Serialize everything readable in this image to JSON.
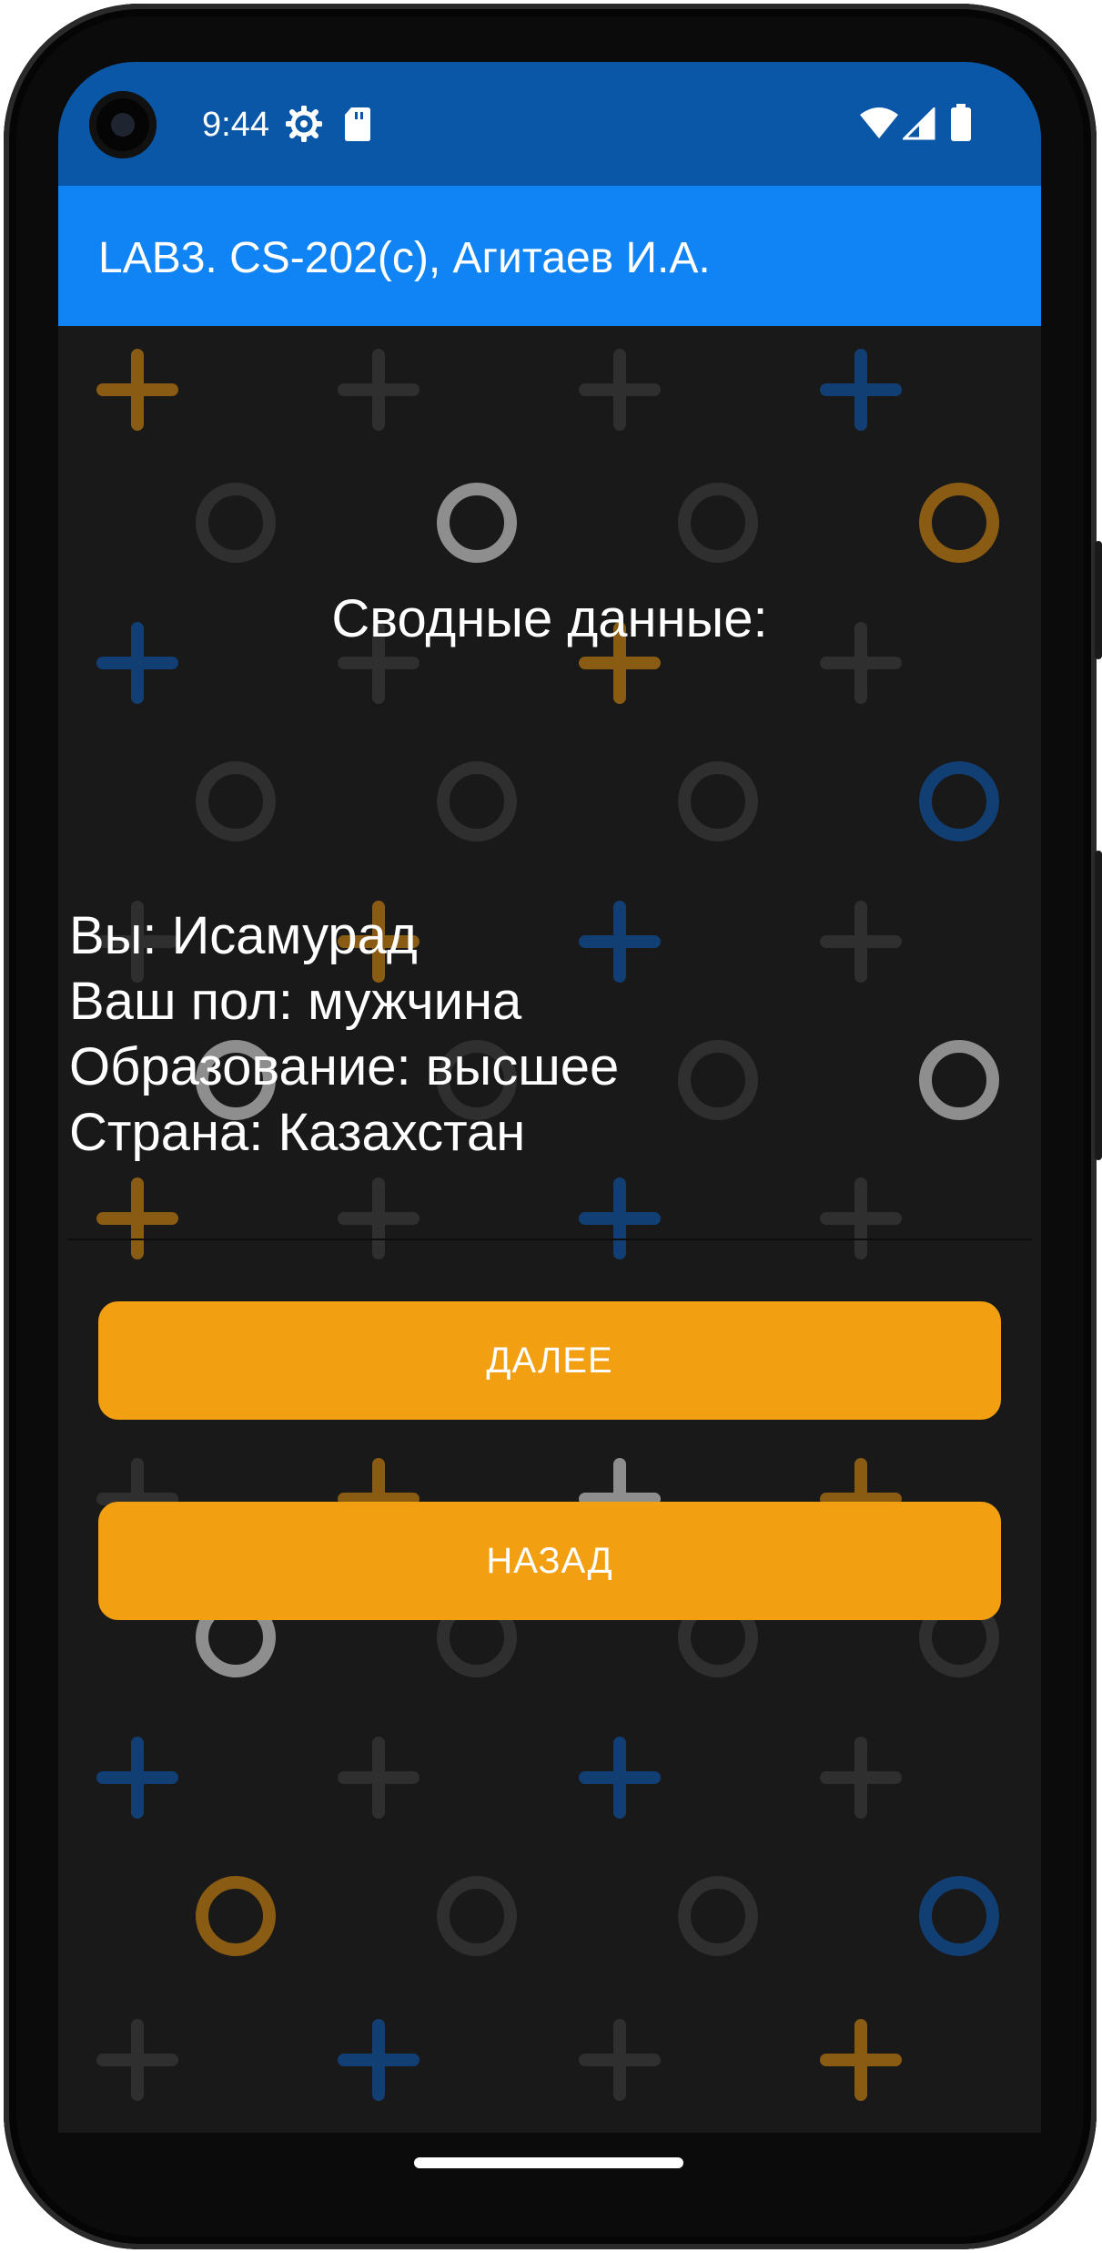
{
  "status_bar": {
    "time": "9:44",
    "icons": [
      "settings-gear-icon",
      "sd-card-icon",
      "wifi-icon",
      "signal-icon",
      "battery-icon"
    ]
  },
  "app_bar": {
    "title": "LAB3. CS-202(с), Агитаев И.А."
  },
  "summary": {
    "heading": "Сводные данные:",
    "lines": [
      "Вы: Исамурад",
      "Ваш пол: мужчина",
      "Образование: высшее",
      "Страна: Казахстан"
    ]
  },
  "buttons": {
    "next_label": "ДАЛЕЕ",
    "back_label": "НАЗАД"
  },
  "colors": {
    "status_bar": "#0a57a8",
    "app_bar": "#1184f5",
    "background": "#191919",
    "button": "#f29f12",
    "pattern_orange": "#8a5b12",
    "pattern_blue": "#123f73",
    "pattern_gray": "#2f2f2f",
    "pattern_light": "#8e8e8e"
  },
  "background_pattern": {
    "description_icons": [
      "plus-icon",
      "circle-icon"
    ]
  }
}
